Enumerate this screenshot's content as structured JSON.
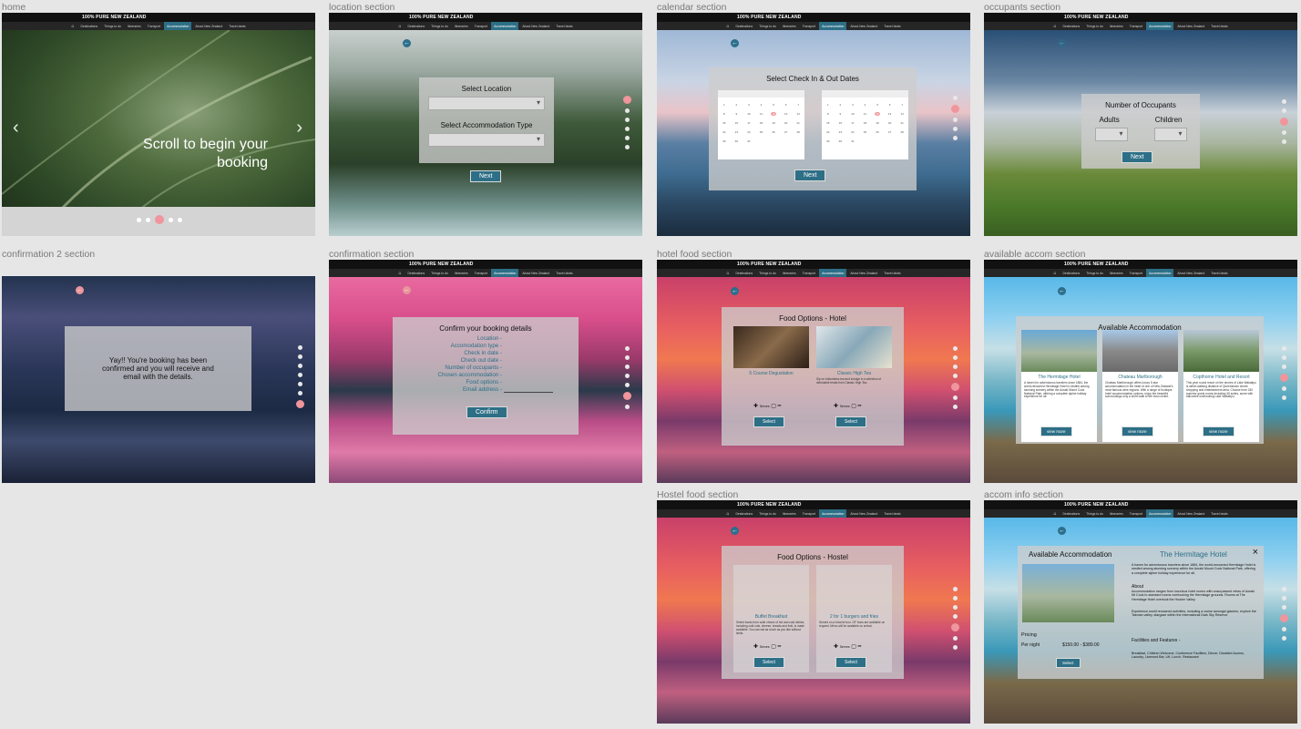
{
  "nav": {
    "brand": "100% PURE NEW ZEALAND",
    "home_icon": "home-icon",
    "items": [
      "Destinations",
      "Things to do",
      "Itineraries",
      "Transport",
      "Accommodation",
      "About New Zealand",
      "Travel deals"
    ],
    "active": "Accommodation"
  },
  "frames": {
    "home": {
      "label": "home",
      "headline_line1": "Scroll to begin your",
      "headline_line2": "booking"
    },
    "location": {
      "label": "location section",
      "title1": "Select Location",
      "title2": "Select Accommodation Type",
      "next": "Next"
    },
    "calendar": {
      "label": "calendar section",
      "title": "Select Check In & Out Dates",
      "next": "Next"
    },
    "occupants": {
      "label": "occupants section",
      "title": "Number of Occupants",
      "adults": "Adults",
      "children": "Children",
      "next": "Next"
    },
    "confirmation2": {
      "label": "confirmation 2 section",
      "message": "Yay!! You're booking has been confirmed and you will receive and email with the details."
    },
    "confirmation": {
      "label": "confirmation section",
      "title": "Confirm your booking details",
      "fields": [
        "Location -",
        "Accomodation type -",
        "Check in date -",
        "Check out date -",
        "Number of occupants -",
        "Chosen accommodation -",
        "Food options -",
        "Email address -"
      ],
      "confirm": "Confirm"
    },
    "hotel_food": {
      "label": "hotel food section",
      "title": "Food Options - Hotel",
      "cards": [
        {
          "name": "5 Course Degustation",
          "desc": ""
        },
        {
          "name": "Classic High Tea",
          "desc": "Sip on bottomless tea and indulge in a selection of delectable treats from Classic High Tea."
        }
      ],
      "serves": "Serves",
      "select": "Select"
    },
    "hostel_food": {
      "label": "Hostel food section",
      "title": "Food Options - Hostel",
      "cards": [
        {
          "name": "Buffet Breakfast",
          "desc": "Select foods from wide choice of hot and cold dishes, including cold cuts, cheese, breads and fruit, is made available. You can eat as much as you like without limits."
        },
        {
          "name": "2 for 1 burgers and fries",
          "desc": "Served on a brioche bun. GF buns are available on request. Menu will be available on arrival."
        }
      ],
      "serves": "Serves",
      "select": "Select"
    },
    "available_accom": {
      "label": "available accom section",
      "title": "Available Accommodation",
      "cards": [
        {
          "name": "The Hermitage Hotel",
          "desc": "A haven for adventurous travelers since 1884, the world-renowned Hermitage Hotel is nestled among stunning scenery within the Aoraki Mount Cook National Park, offering a complete alpine holiday experience for all."
        },
        {
          "name": "Chateau Marlborough",
          "desc": "Chateau Marlborough offers luxury 5 star accommodation in the heart of one of New Zealand's most famous wine regions. With a range of boutique hotel accommodation options, enjoy the beautiful surroundings only a short walk to the town centre."
        },
        {
          "name": "Copthorne Hotel and Resort",
          "desc": "This year round resort on the shores of Lake Wakatipu is within walking distance of Queenstown centre shopping and entertainment area. Choose from 240 superior guest rooms including 36 suites, some with balconies overlooking Lake Wakatipu."
        }
      ],
      "view_more": "view more"
    },
    "accom_info": {
      "label": "accom info section",
      "title": "Available Accommodation",
      "hotel": "The Hermitage Hotel",
      "intro": "A haven for adventurous travelers since 1884, the world-renowned Hermitage Hotel is nestled among stunning scenery within the Aoraki Mount Cook National Park, offering a complete alpine holiday experience for all.",
      "about_heading": "About",
      "about": "Accommodation ranges from luxurious hotel rooms with unsurpassed views of Aoraki Mt Cook to standard rooms overlooking the Hermitage grounds. Rooms at The Hermitage Hotel overlook the Hooker Valley.",
      "about2": "Experience world renowned activities, including a cruise amongst glaciers, explore the Tasman valley, stargaze within the International Dark Sky Reserve.",
      "pricing": "Pricing",
      "per_night": "Per night",
      "price": "$150.00 - $389.00",
      "facilities_heading": "Facilities and Features -",
      "facilities": "Breakfast, Children Welcome, Conference Facilities, Dinner, Disabled Access, Laundry, Licensed Bar, Lift, Lunch, Restaurant",
      "select": "Select",
      "close": "×"
    }
  }
}
